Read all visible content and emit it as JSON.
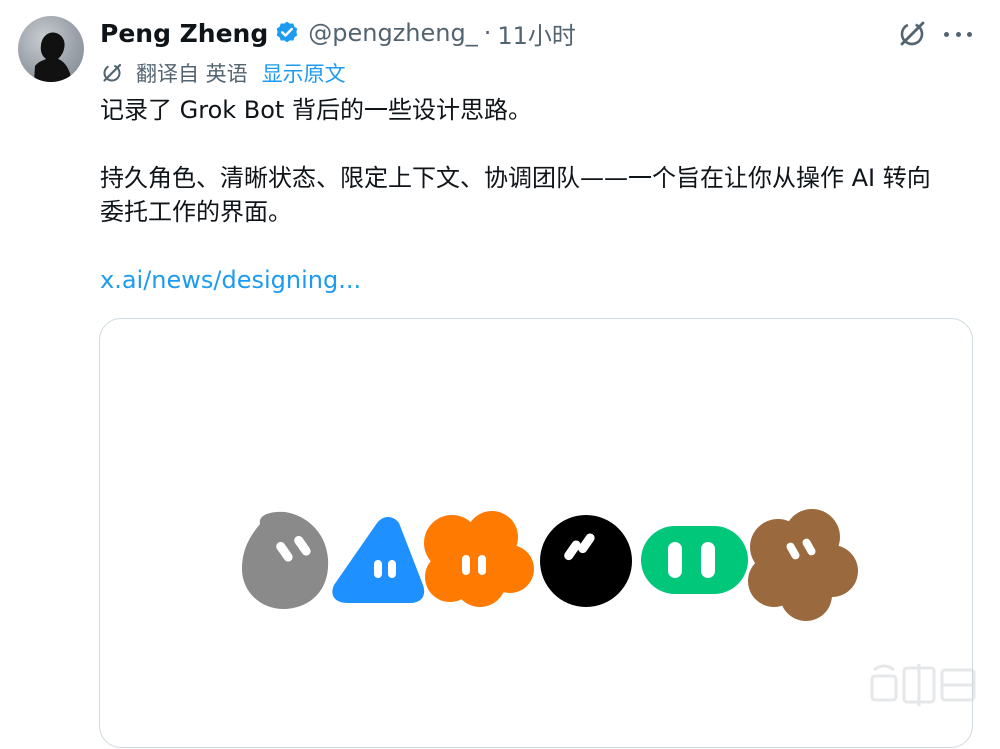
{
  "author": {
    "display_name": "Peng Zheng",
    "handle": "@pengzheng_",
    "separator": "·",
    "time_ago": "11小时"
  },
  "translation": {
    "label": "翻译自 英语",
    "show_original": "显示原文"
  },
  "tweet": {
    "line1": "记录了 Grok Bot 背后的一些设计思路。",
    "line2": "持久角色、清晰状态、限定上下文、协调团队——一个旨在让你从操作 AI 转向",
    "line3": "委托工作的界面。",
    "link": "x.ai/news/designing..."
  },
  "card": {
    "mascots": [
      {
        "name": "gray-drop",
        "color": "#8a8a8a"
      },
      {
        "name": "blue-triangle",
        "color": "#1e90ff"
      },
      {
        "name": "orange-cloud",
        "color": "#ff7a00"
      },
      {
        "name": "black-circle",
        "color": "#000000"
      },
      {
        "name": "green-pill",
        "color": "#00c77a"
      },
      {
        "name": "brown-flower",
        "color": "#9a6a3e"
      }
    ]
  },
  "colors": {
    "link": "#1d9bf0",
    "verified": "#1d9bf0",
    "muted": "#536471"
  }
}
